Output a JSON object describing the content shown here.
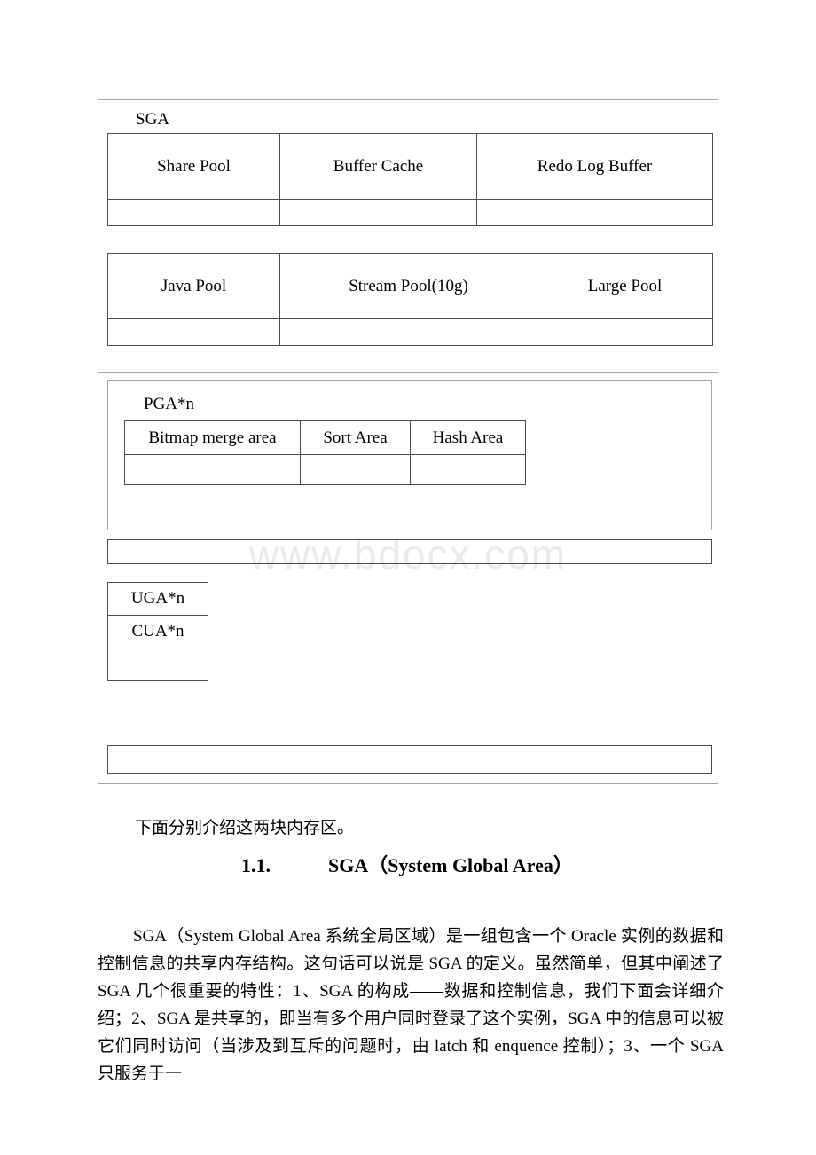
{
  "document": {
    "watermark": "www.bdocx.com"
  },
  "diagram": {
    "sga": {
      "label": "SGA",
      "pool_row_1": [
        "Share Pool",
        "Buffer Cache",
        "Redo Log Buffer"
      ],
      "pool_row_1_empty": [
        "",
        "",
        ""
      ],
      "pool_row_2": [
        "Java Pool",
        "Stream Pool(10g)",
        "Large Pool"
      ],
      "pool_row_2_empty": [
        "",
        "",
        ""
      ]
    },
    "pga": {
      "label": "PGA*n",
      "areas": [
        "Bitmap merge area",
        "Sort Area",
        "Hash Area"
      ],
      "areas_empty": [
        "",
        "",
        ""
      ],
      "stack": [
        "UGA*n",
        "CUA*n",
        ""
      ]
    }
  },
  "body": {
    "intro": "下面分别介绍这两块内存区。",
    "heading_number": "1.1.",
    "heading_title": "SGA（System Global Area）",
    "paragraph": "SGA（System Global Area 系统全局区域）是一组包含一个 Oracle 实例的数据和控制信息的共享内存结构。这句话可以说是 SGA 的定义。虽然简单，但其中阐述了 SGA 几个很重要的特性：1、SGA 的构成——数据和控制信息，我们下面会详细介绍；2、SGA 是共享的，即当有多个用户同时登录了这个实例，SGA 中的信息可以被它们同时访问（当涉及到互斥的问题时，由 latch 和 enquence 控制）；3、一个 SGA 只服务于一"
  }
}
